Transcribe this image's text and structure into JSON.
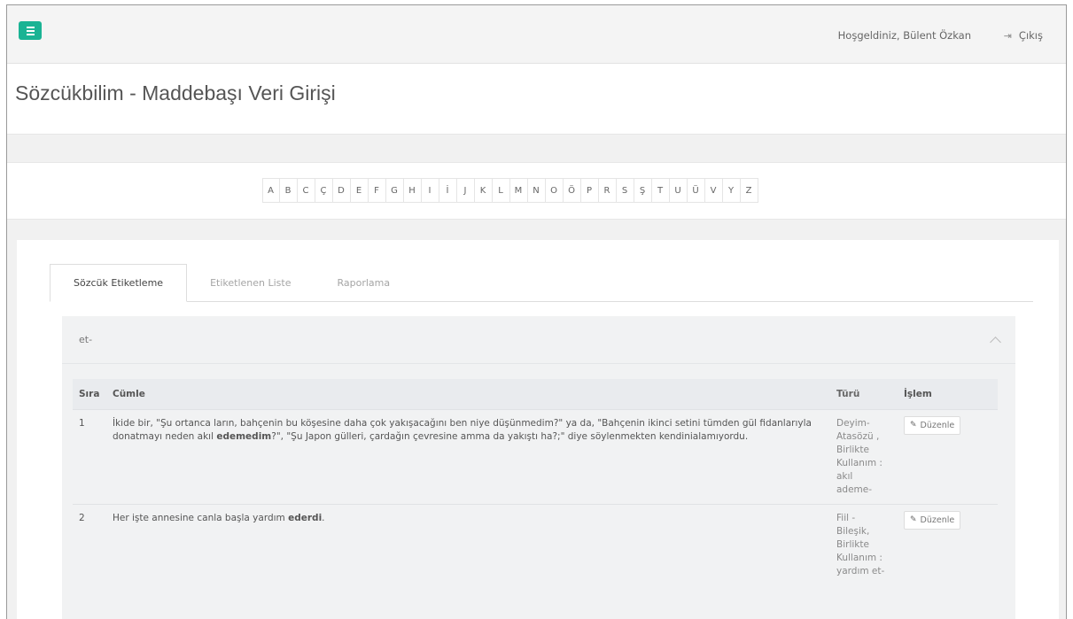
{
  "header": {
    "welcome": "Hoşgeldiniz, Bülent Özkan",
    "logout_label": "Çıkış"
  },
  "page": {
    "title": "Sözcükbilim - Maddebaşı Veri Girişi"
  },
  "alphabet": [
    "A",
    "B",
    "C",
    "Ç",
    "D",
    "E",
    "F",
    "G",
    "H",
    "I",
    "İ",
    "J",
    "K",
    "L",
    "M",
    "N",
    "O",
    "Ö",
    "P",
    "R",
    "S",
    "Ş",
    "T",
    "U",
    "Ü",
    "V",
    "Y",
    "Z"
  ],
  "tabs": [
    {
      "label": "Sözcük Etiketleme",
      "active": true
    },
    {
      "label": "Etiketlenen Liste",
      "active": false
    },
    {
      "label": "Raporlama",
      "active": false
    }
  ],
  "panel": {
    "title": "et-"
  },
  "table": {
    "columns": [
      "Sıra",
      "Cümle",
      "Türü",
      "İşlem"
    ],
    "rows": [
      {
        "index": "1",
        "sentence_before": "İkide bir, \"Şu ortanca ların, bahçenin bu köşesine daha çok yakışacağını ben niye düşünmedim?\" ya da, \"Bahçenin ikinci setini tümden gül fidanlarıyla donatmayı neden akıl ",
        "sentence_bold": "edemedim",
        "sentence_after": "?\", \"Şu Japon gülleri, çardağın çevresine amma da yakıştı ha?;\" diye söylenmekten kendinialamıyordu.",
        "type": "Deyim-Atasözü , Birlikte Kullanım : akıl ademe-",
        "action": "Düzenle"
      },
      {
        "index": "2",
        "sentence_before": "Her işte annesine canla başla yardım ",
        "sentence_bold": "ederdi",
        "sentence_after": ".",
        "type": "Fiil - Bileşik, Birlikte Kullanım : yardım et-",
        "action": "Düzenle"
      }
    ]
  },
  "colors": {
    "accent": "#1ab394"
  },
  "icons": {
    "menu": "bars-icon",
    "logout": "sign-out-icon",
    "edit": "pencil-icon",
    "collapse": "chevron-up-icon"
  }
}
